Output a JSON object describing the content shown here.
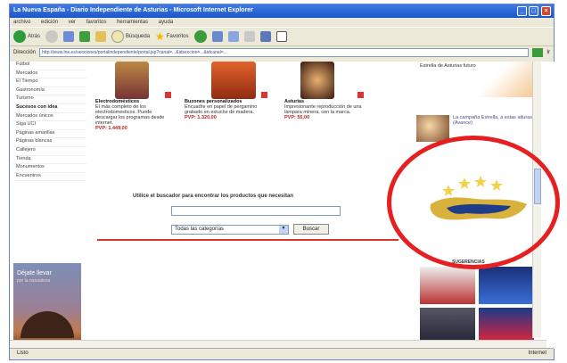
{
  "window": {
    "title": "La Nueva España - Diario Independiente de Asturias - Microsoft Internet Explorer",
    "min_label": "_",
    "max_label": "□",
    "close_label": "×"
  },
  "menu": [
    "archivo",
    "edición",
    "ver",
    "favoritos",
    "herramientas",
    "ayuda"
  ],
  "toolbar": {
    "back_label": "Atrás",
    "search_label": "Búsqueda",
    "favorites_label": "Favoritos"
  },
  "address": {
    "label": "Dirección",
    "url": "http://www.lne.es/secciones/portalindependiente/portal.jsp?canal=...&idseccion=...&idcanal=...",
    "go_label": "Ir"
  },
  "left_nav": [
    "Fútbol",
    "Mercados",
    "El Tiempo",
    "Gastronomía",
    "Turismo",
    "Sucesos con idea",
    "Mercados únicos",
    "Siga UCI",
    "Páginas amarillas",
    "Páginas blancas",
    "Callejero",
    "Tienda",
    "Monumentos",
    "Encuentros"
  ],
  "left_nav_selected": "Sucesos con idea",
  "promo": {
    "line1": "Déjate llevar",
    "line2": "por la naturaleza"
  },
  "products": [
    {
      "title": "Electrodomésticos",
      "desc": "El más completo de los electrodomésticos. Puede descargar los programas desde internet.",
      "price": "PVP: 1.449,00"
    },
    {
      "title": "Buzones personalizados",
      "desc": "Encuadre en papel de pergamino grabado en estuche de madera.",
      "price": "PVP: 1.320,00"
    },
    {
      "title": "Asturias",
      "desc": "Impresionante reproducción de una lámpara minera, con la marca.",
      "price": "PVP: 55,00"
    }
  ],
  "search": {
    "label": "Utilice el buscador para encontrar los productos que necesitan",
    "category": "Todas las categorías",
    "button": "Buscar"
  },
  "right": {
    "top_title": "Estrella de Asturias futuro",
    "news_text": "La campaña Estrella, a estas alturas (Avance)",
    "suggestions_title": "SUGERENCIAS"
  },
  "status": {
    "left": "Listo",
    "right": "Internet"
  },
  "colors": {
    "highlight_ellipse": "#e62020",
    "map_land": "#d8b23c",
    "map_water": "#1d3c8a",
    "stars": "#f2d24a"
  }
}
